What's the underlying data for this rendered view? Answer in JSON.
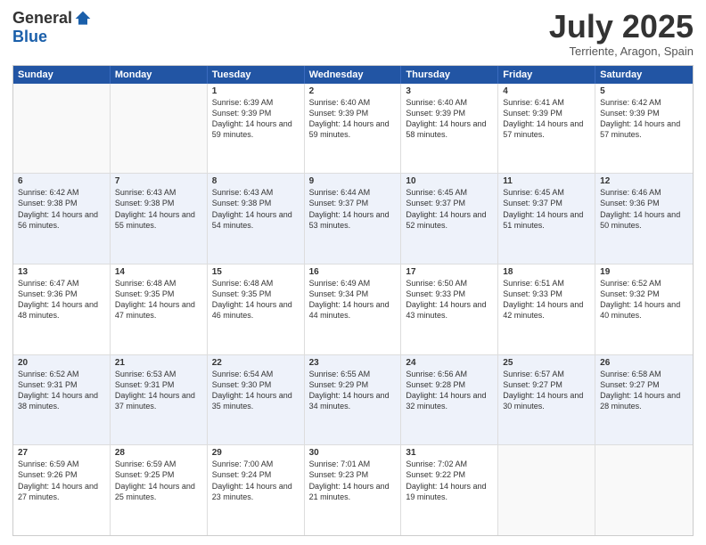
{
  "logo": {
    "general": "General",
    "blue": "Blue"
  },
  "title": "July 2025",
  "location": "Terriente, Aragon, Spain",
  "weekdays": [
    "Sunday",
    "Monday",
    "Tuesday",
    "Wednesday",
    "Thursday",
    "Friday",
    "Saturday"
  ],
  "weeks": [
    [
      {
        "day": "",
        "sunrise": "",
        "sunset": "",
        "daylight": ""
      },
      {
        "day": "",
        "sunrise": "",
        "sunset": "",
        "daylight": ""
      },
      {
        "day": "1",
        "sunrise": "Sunrise: 6:39 AM",
        "sunset": "Sunset: 9:39 PM",
        "daylight": "Daylight: 14 hours and 59 minutes."
      },
      {
        "day": "2",
        "sunrise": "Sunrise: 6:40 AM",
        "sunset": "Sunset: 9:39 PM",
        "daylight": "Daylight: 14 hours and 59 minutes."
      },
      {
        "day": "3",
        "sunrise": "Sunrise: 6:40 AM",
        "sunset": "Sunset: 9:39 PM",
        "daylight": "Daylight: 14 hours and 58 minutes."
      },
      {
        "day": "4",
        "sunrise": "Sunrise: 6:41 AM",
        "sunset": "Sunset: 9:39 PM",
        "daylight": "Daylight: 14 hours and 57 minutes."
      },
      {
        "day": "5",
        "sunrise": "Sunrise: 6:42 AM",
        "sunset": "Sunset: 9:39 PM",
        "daylight": "Daylight: 14 hours and 57 minutes."
      }
    ],
    [
      {
        "day": "6",
        "sunrise": "Sunrise: 6:42 AM",
        "sunset": "Sunset: 9:38 PM",
        "daylight": "Daylight: 14 hours and 56 minutes."
      },
      {
        "day": "7",
        "sunrise": "Sunrise: 6:43 AM",
        "sunset": "Sunset: 9:38 PM",
        "daylight": "Daylight: 14 hours and 55 minutes."
      },
      {
        "day": "8",
        "sunrise": "Sunrise: 6:43 AM",
        "sunset": "Sunset: 9:38 PM",
        "daylight": "Daylight: 14 hours and 54 minutes."
      },
      {
        "day": "9",
        "sunrise": "Sunrise: 6:44 AM",
        "sunset": "Sunset: 9:37 PM",
        "daylight": "Daylight: 14 hours and 53 minutes."
      },
      {
        "day": "10",
        "sunrise": "Sunrise: 6:45 AM",
        "sunset": "Sunset: 9:37 PM",
        "daylight": "Daylight: 14 hours and 52 minutes."
      },
      {
        "day": "11",
        "sunrise": "Sunrise: 6:45 AM",
        "sunset": "Sunset: 9:37 PM",
        "daylight": "Daylight: 14 hours and 51 minutes."
      },
      {
        "day": "12",
        "sunrise": "Sunrise: 6:46 AM",
        "sunset": "Sunset: 9:36 PM",
        "daylight": "Daylight: 14 hours and 50 minutes."
      }
    ],
    [
      {
        "day": "13",
        "sunrise": "Sunrise: 6:47 AM",
        "sunset": "Sunset: 9:36 PM",
        "daylight": "Daylight: 14 hours and 48 minutes."
      },
      {
        "day": "14",
        "sunrise": "Sunrise: 6:48 AM",
        "sunset": "Sunset: 9:35 PM",
        "daylight": "Daylight: 14 hours and 47 minutes."
      },
      {
        "day": "15",
        "sunrise": "Sunrise: 6:48 AM",
        "sunset": "Sunset: 9:35 PM",
        "daylight": "Daylight: 14 hours and 46 minutes."
      },
      {
        "day": "16",
        "sunrise": "Sunrise: 6:49 AM",
        "sunset": "Sunset: 9:34 PM",
        "daylight": "Daylight: 14 hours and 44 minutes."
      },
      {
        "day": "17",
        "sunrise": "Sunrise: 6:50 AM",
        "sunset": "Sunset: 9:33 PM",
        "daylight": "Daylight: 14 hours and 43 minutes."
      },
      {
        "day": "18",
        "sunrise": "Sunrise: 6:51 AM",
        "sunset": "Sunset: 9:33 PM",
        "daylight": "Daylight: 14 hours and 42 minutes."
      },
      {
        "day": "19",
        "sunrise": "Sunrise: 6:52 AM",
        "sunset": "Sunset: 9:32 PM",
        "daylight": "Daylight: 14 hours and 40 minutes."
      }
    ],
    [
      {
        "day": "20",
        "sunrise": "Sunrise: 6:52 AM",
        "sunset": "Sunset: 9:31 PM",
        "daylight": "Daylight: 14 hours and 38 minutes."
      },
      {
        "day": "21",
        "sunrise": "Sunrise: 6:53 AM",
        "sunset": "Sunset: 9:31 PM",
        "daylight": "Daylight: 14 hours and 37 minutes."
      },
      {
        "day": "22",
        "sunrise": "Sunrise: 6:54 AM",
        "sunset": "Sunset: 9:30 PM",
        "daylight": "Daylight: 14 hours and 35 minutes."
      },
      {
        "day": "23",
        "sunrise": "Sunrise: 6:55 AM",
        "sunset": "Sunset: 9:29 PM",
        "daylight": "Daylight: 14 hours and 34 minutes."
      },
      {
        "day": "24",
        "sunrise": "Sunrise: 6:56 AM",
        "sunset": "Sunset: 9:28 PM",
        "daylight": "Daylight: 14 hours and 32 minutes."
      },
      {
        "day": "25",
        "sunrise": "Sunrise: 6:57 AM",
        "sunset": "Sunset: 9:27 PM",
        "daylight": "Daylight: 14 hours and 30 minutes."
      },
      {
        "day": "26",
        "sunrise": "Sunrise: 6:58 AM",
        "sunset": "Sunset: 9:27 PM",
        "daylight": "Daylight: 14 hours and 28 minutes."
      }
    ],
    [
      {
        "day": "27",
        "sunrise": "Sunrise: 6:59 AM",
        "sunset": "Sunset: 9:26 PM",
        "daylight": "Daylight: 14 hours and 27 minutes."
      },
      {
        "day": "28",
        "sunrise": "Sunrise: 6:59 AM",
        "sunset": "Sunset: 9:25 PM",
        "daylight": "Daylight: 14 hours and 25 minutes."
      },
      {
        "day": "29",
        "sunrise": "Sunrise: 7:00 AM",
        "sunset": "Sunset: 9:24 PM",
        "daylight": "Daylight: 14 hours and 23 minutes."
      },
      {
        "day": "30",
        "sunrise": "Sunrise: 7:01 AM",
        "sunset": "Sunset: 9:23 PM",
        "daylight": "Daylight: 14 hours and 21 minutes."
      },
      {
        "day": "31",
        "sunrise": "Sunrise: 7:02 AM",
        "sunset": "Sunset: 9:22 PM",
        "daylight": "Daylight: 14 hours and 19 minutes."
      },
      {
        "day": "",
        "sunrise": "",
        "sunset": "",
        "daylight": ""
      },
      {
        "day": "",
        "sunrise": "",
        "sunset": "",
        "daylight": ""
      }
    ]
  ]
}
